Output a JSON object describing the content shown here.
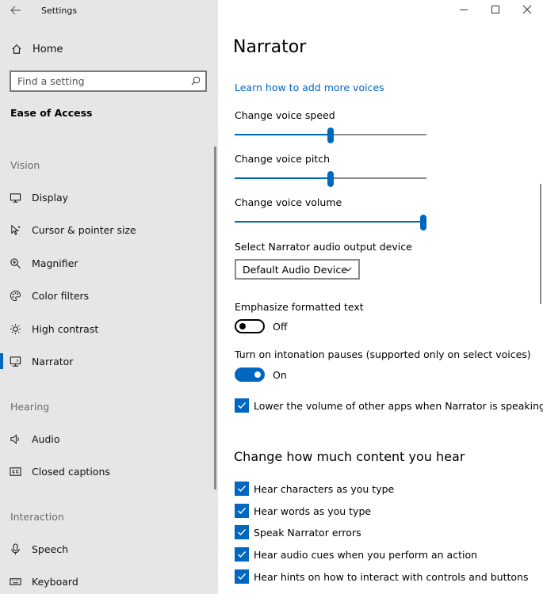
{
  "window": {
    "title": "Settings",
    "controls": {
      "minimize": "minimize-icon",
      "maximize": "maximize-icon",
      "close": "close-icon"
    }
  },
  "sidebar": {
    "home_label": "Home",
    "search_placeholder": "Find a setting",
    "section_title": "Ease of Access",
    "groups": {
      "vision": "Vision",
      "hearing": "Hearing",
      "interaction": "Interaction"
    },
    "items": [
      {
        "label": "Display",
        "icon": "monitor-icon"
      },
      {
        "label": "Cursor & pointer size",
        "icon": "cursor-icon"
      },
      {
        "label": "Magnifier",
        "icon": "magnifier-icon"
      },
      {
        "label": "Color filters",
        "icon": "color-palette-icon"
      },
      {
        "label": "High contrast",
        "icon": "brightness-icon"
      },
      {
        "label": "Narrator",
        "icon": "narrator-icon",
        "active": true
      },
      {
        "label": "Audio",
        "icon": "speaker-icon"
      },
      {
        "label": "Closed captions",
        "icon": "cc-icon"
      },
      {
        "label": "Speech",
        "icon": "microphone-icon"
      },
      {
        "label": "Keyboard",
        "icon": "keyboard-icon"
      }
    ]
  },
  "main": {
    "title": "Narrator",
    "voices_link": "Learn how to add more voices",
    "speed": {
      "label": "Change voice speed",
      "value": 0.5
    },
    "pitch": {
      "label": "Change voice pitch",
      "value": 0.5
    },
    "volume": {
      "label": "Change voice volume",
      "value": 1.0
    },
    "audio_device": {
      "label": "Select Narrator audio output device",
      "value": "Default Audio Device"
    },
    "emphasize": {
      "label": "Emphasize formatted text",
      "state": "Off"
    },
    "intonation": {
      "label": "Turn on intonation pauses (supported only on select voices)",
      "state": "On"
    },
    "lower_volume": {
      "label": "Lower the volume of other apps when Narrator is speaking",
      "checked": true
    },
    "content_heading": "Change how much content you hear",
    "content_options": [
      {
        "label": "Hear characters as you type",
        "checked": true
      },
      {
        "label": "Hear words as you type",
        "checked": true
      },
      {
        "label": "Speak Narrator errors",
        "checked": true
      },
      {
        "label": "Hear audio cues when you perform an action",
        "checked": true
      },
      {
        "label": "Hear hints on how to interact with controls and buttons",
        "checked": true
      }
    ],
    "accent_color": "#0067c0"
  }
}
